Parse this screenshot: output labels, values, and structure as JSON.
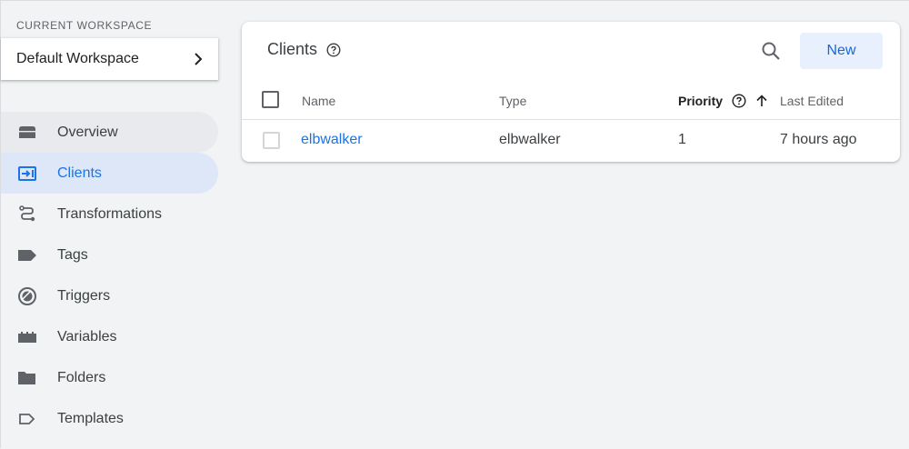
{
  "sidebar": {
    "workspace_label": "CURRENT WORKSPACE",
    "workspace_name": "Default Workspace",
    "items": [
      {
        "label": "Overview",
        "icon": "overview-icon"
      },
      {
        "label": "Clients",
        "icon": "clients-icon"
      },
      {
        "label": "Transformations",
        "icon": "transformations-icon"
      },
      {
        "label": "Tags",
        "icon": "tag-icon"
      },
      {
        "label": "Triggers",
        "icon": "trigger-icon"
      },
      {
        "label": "Variables",
        "icon": "variables-icon"
      },
      {
        "label": "Folders",
        "icon": "folder-icon"
      },
      {
        "label": "Templates",
        "icon": "templates-icon"
      }
    ],
    "active_item": "Clients",
    "hover_item": "Overview"
  },
  "main": {
    "title": "Clients",
    "new_button_label": "New",
    "table": {
      "columns": [
        "Name",
        "Type",
        "Priority",
        "Last Edited"
      ],
      "sorted_column": "Priority",
      "sort_direction": "ascending",
      "rows": [
        {
          "name": "elbwalker",
          "type": "elbwalker",
          "priority": "1",
          "last_edited": "7 hours ago"
        }
      ]
    }
  },
  "colors": {
    "accent": "#1a73e8",
    "active_nav_bg": "#dde7f8",
    "new_button_bg": "#e8f0fe",
    "background": "#f1f3f4"
  }
}
